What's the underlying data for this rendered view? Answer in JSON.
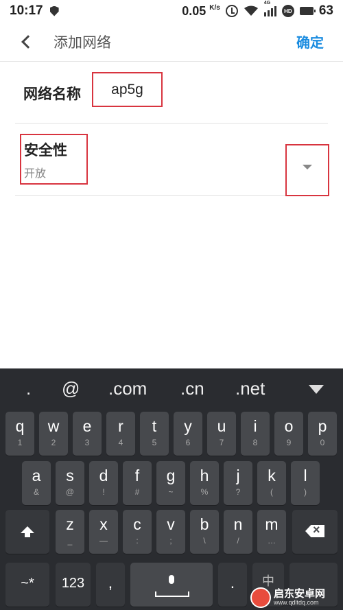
{
  "status_bar": {
    "time": "10:17",
    "speed": "0.05",
    "speed_unit": "K/s",
    "network_tag": "4G",
    "hd_label": "HD",
    "battery": "63"
  },
  "header": {
    "title": "添加网络",
    "confirm_label": "确定"
  },
  "form": {
    "name_label": "网络名称",
    "name_value": "ap5g",
    "security_label": "安全性",
    "security_value": "开放"
  },
  "keyboard": {
    "suggestions": [
      ".",
      "@",
      ".com",
      ".cn",
      ".net"
    ],
    "row1": [
      {
        "key": "q",
        "sub": "1"
      },
      {
        "key": "w",
        "sub": "2"
      },
      {
        "key": "e",
        "sub": "3"
      },
      {
        "key": "r",
        "sub": "4"
      },
      {
        "key": "t",
        "sub": "5"
      },
      {
        "key": "y",
        "sub": "6"
      },
      {
        "key": "u",
        "sub": "7"
      },
      {
        "key": "i",
        "sub": "8"
      },
      {
        "key": "o",
        "sub": "9"
      },
      {
        "key": "p",
        "sub": "0"
      }
    ],
    "row2": [
      {
        "key": "a",
        "sub": "&"
      },
      {
        "key": "s",
        "sub": "@"
      },
      {
        "key": "d",
        "sub": "!"
      },
      {
        "key": "f",
        "sub": "#"
      },
      {
        "key": "g",
        "sub": "~"
      },
      {
        "key": "h",
        "sub": "%"
      },
      {
        "key": "j",
        "sub": "?"
      },
      {
        "key": "k",
        "sub": "("
      },
      {
        "key": "l",
        "sub": ")"
      }
    ],
    "row3": [
      {
        "key": "z",
        "sub": "_"
      },
      {
        "key": "x",
        "sub": "—"
      },
      {
        "key": "c",
        "sub": ":"
      },
      {
        "key": "v",
        "sub": ";"
      },
      {
        "key": "b",
        "sub": "\\"
      },
      {
        "key": "n",
        "sub": "/"
      },
      {
        "key": "m",
        "sub": "…"
      }
    ],
    "symbols_label": "~*",
    "numbers_label": "123",
    "comma_label": ",",
    "period_label": ".",
    "lang_label": "中"
  },
  "watermark": {
    "name": "启东安卓网",
    "url": "www.qdltdq.com"
  }
}
